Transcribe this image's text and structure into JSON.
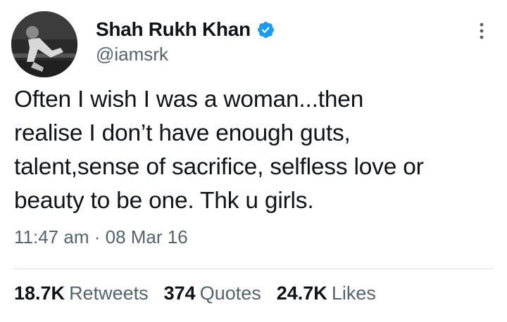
{
  "author": {
    "display_name": "Shah Rukh Khan",
    "handle": "@iamsrk",
    "avatar_icon": "profile-photo",
    "verified_icon": "verified-badge-icon",
    "verified_color": "#1d9bf0"
  },
  "more_icon": "more-options-icon",
  "tweet": {
    "text": "Often I wish I was a woman...then\nrealise I don’t have enough guts,\ntalent,sense of sacrifice, selfless love or\nbeauty to be one. Thk u girls.",
    "time": "11:47 am",
    "separator": "·",
    "date": "08 Mar 16"
  },
  "stats": {
    "retweets_count": "18.7K",
    "retweets_label": "Retweets",
    "quotes_count": "374",
    "quotes_label": "Quotes",
    "likes_count": "24.7K",
    "likes_label": "Likes"
  },
  "colors": {
    "text_primary": "#0f1419",
    "text_secondary": "#536471",
    "divider": "#dfe3e6"
  }
}
